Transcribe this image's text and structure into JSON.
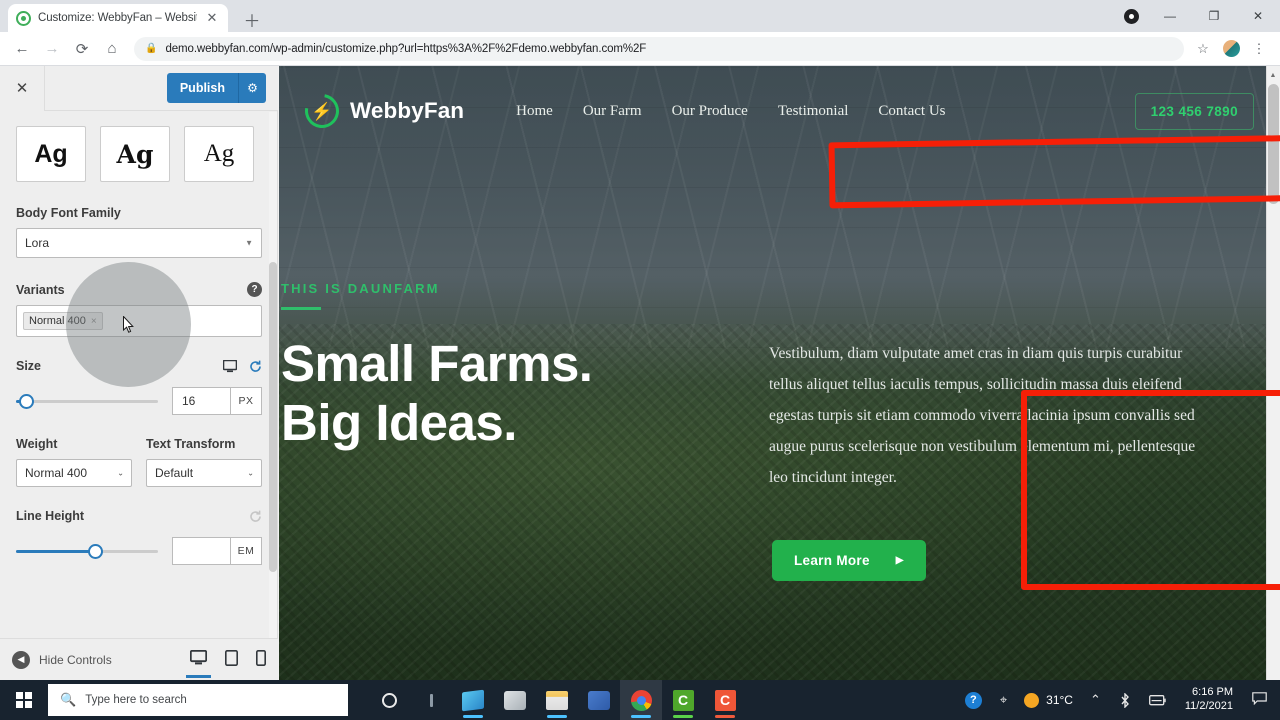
{
  "browser": {
    "tab": {
      "title": "Customize: WebbyFan – Website",
      "favicon_icon": "wordpress-icon",
      "close_icon": "close-icon"
    },
    "new_tab_icon": "plus-icon",
    "window_controls": {
      "extension_icon": "extension-dot-icon",
      "minimize": "–",
      "maximize": "maximize-icon",
      "close": "✕"
    },
    "toolbar": {
      "back_icon": "arrow-left-icon",
      "forward_icon": "arrow-right-icon",
      "reload_icon": "reload-icon",
      "home_icon": "home-icon",
      "lock_icon": "lock-icon",
      "url": "demo.webbyfan.com/wp-admin/customize.php?url=https%3A%2F%2Fdemo.webbyfan.com%2F",
      "bookmark_icon": "star-icon",
      "profile_icon": "avatar-icon",
      "menu_icon": "three-dot-menu-icon"
    }
  },
  "customizer": {
    "close_icon": "close-icon",
    "publish_label": "Publish",
    "publish_gear_icon": "gear-icon",
    "font_previews": [
      {
        "label": "Ag",
        "style": "sans"
      },
      {
        "label": "Ag",
        "style": "serif-bold"
      },
      {
        "label": "Ag",
        "style": "serif"
      }
    ],
    "body_font_family": {
      "label": "Body Font Family",
      "value": "Lora",
      "caret_icon": "chevron-down-icon"
    },
    "variants": {
      "label": "Variants",
      "help_icon": "help-icon",
      "chips": [
        {
          "label": "Normal 400",
          "remove_icon": "×"
        }
      ]
    },
    "size": {
      "label": "Size",
      "device_icon": "desktop-icon",
      "reset_icon": "reset-icon",
      "value": "16",
      "unit": "PX",
      "slider_percent": 6
    },
    "weight": {
      "label": "Weight",
      "value": "Normal 400",
      "caret_icon": "chevron-down-icon"
    },
    "text_transform": {
      "label": "Text Transform",
      "value": "Default",
      "caret_icon": "chevron-down-icon"
    },
    "line_height": {
      "label": "Line Height",
      "reset_icon": "reset-icon",
      "value": "",
      "unit": "EM",
      "slider_percent": 55
    },
    "footer": {
      "hide_controls_label": "Hide Controls",
      "hide_icon": "chevron-left-icon",
      "devices": [
        {
          "name": "desktop-preview",
          "icon": "desktop-icon",
          "active": true
        },
        {
          "name": "tablet-preview",
          "icon": "tablet-icon",
          "active": false
        },
        {
          "name": "mobile-preview",
          "icon": "mobile-icon",
          "active": false
        }
      ]
    }
  },
  "site": {
    "logo": {
      "text": "WebbyFan",
      "mark_icon": "leaf-circle-icon"
    },
    "nav": [
      {
        "label": "Home"
      },
      {
        "label": "Our Farm"
      },
      {
        "label": "Our Produce"
      },
      {
        "label": "Testimonial"
      },
      {
        "label": "Contact Us"
      }
    ],
    "phone": "123 456 7890",
    "hero": {
      "eyebrow": "THIS IS DAUNFARM",
      "heading_line1": "Small Farms.",
      "heading_line2": "Big Ideas.",
      "paragraph": "Vestibulum, diam vulputate amet cras in diam quis turpis curabitur tellus aliquet tellus iaculis tempus, sollicitudin massa duis eleifend egestas turpis sit etiam commodo viverra lacinia ipsum convallis sed augue purus scelerisque non vestibulum elementum mi, pellentesque leo tincidunt integer.",
      "cta_label": "Learn More",
      "cta_arrow_icon": "arrow-right-icon"
    }
  },
  "annotations": {
    "accent_color": "#f61f07",
    "nav_box": "red-rectangle-around-navigation",
    "paragraph_box": "red-rectangle-around-paragraph"
  },
  "taskbar": {
    "start_icon": "windows-logo-icon",
    "search_placeholder": "Type here to search",
    "search_icon": "search-icon",
    "apps": [
      {
        "name": "cortana-icon"
      },
      {
        "name": "task-view-icon"
      },
      {
        "name": "microsoft-store-icon"
      },
      {
        "name": "mail-icon"
      },
      {
        "name": "file-explorer-icon"
      },
      {
        "name": "powerpoint-icon"
      },
      {
        "name": "chrome-icon"
      },
      {
        "name": "camtasia-green-icon"
      },
      {
        "name": "camtasia-red-icon"
      }
    ],
    "tray": {
      "help_icon": "help-circle-icon",
      "pen_icon": "pen-workspace-icon",
      "weather_icon": "sun-icon",
      "temperature": "31°C",
      "chevron_icon": "chevron-up-icon",
      "bluetooth_icon": "bluetooth-icon",
      "battery_icon": "battery-icon",
      "time": "6:16 PM",
      "date": "11/2/2021",
      "notifications_icon": "notification-icon"
    }
  }
}
